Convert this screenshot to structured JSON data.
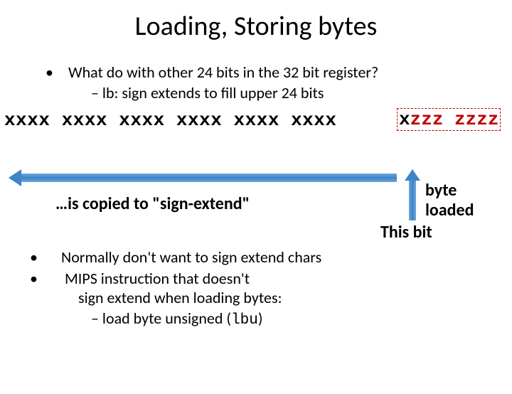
{
  "title": "Loading, Storing bytes",
  "bullets": {
    "q": "What do with other 24 bits in the 32 bit register?",
    "q_sub": "– lb: sign extends to fill upper 24 bits",
    "normally": "Normally don't want to sign extend chars",
    "mips1": "MIPS instruction that doesn't",
    "mips2": "sign extend when loading bytes:",
    "mips_sub_pre": "–  load byte unsigned (",
    "mips_sub_code": "lbu",
    "mips_sub_post": ")"
  },
  "bits": {
    "x_groups": "xxxx xxxx xxxx xxxx xxxx xxxx",
    "box_x": "x",
    "box_z1": "zzz ",
    "box_z2": "zzzz"
  },
  "labels": {
    "copied": "…is copied to \"sign-extend\"",
    "byte": "byte",
    "loaded": "loaded",
    "this_bit": "This bit"
  },
  "glyphs": {
    "bullet": "•"
  }
}
